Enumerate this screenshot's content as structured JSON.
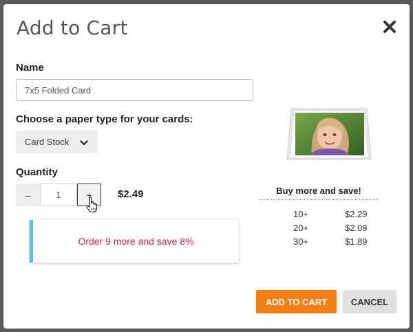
{
  "dialog": {
    "title": "Add to Cart",
    "close_icon": "close-icon"
  },
  "name_field": {
    "label": "Name",
    "value": "7x5 Folded Card"
  },
  "paper_type": {
    "label": "Choose a paper type for your cards:",
    "selected": "Card Stock",
    "icon": "chevron-down-icon"
  },
  "quantity": {
    "label": "Quantity",
    "minus_label": "–",
    "plus_label": "+",
    "value": "1",
    "price": "$2.49"
  },
  "promo": {
    "text": "Order 9 more and save 8%",
    "color": "#c7254e",
    "accent": "#5bc0de"
  },
  "volume_discount": {
    "title": "Buy more and save!",
    "tiers": [
      {
        "qty": "10+",
        "price": "$2.29"
      },
      {
        "qty": "20+",
        "price": "$2.09"
      },
      {
        "qty": "30+",
        "price": "$1.89"
      }
    ]
  },
  "actions": {
    "add_label": "ADD TO CART",
    "cancel_label": "CANCEL",
    "add_color": "#f77e14"
  }
}
